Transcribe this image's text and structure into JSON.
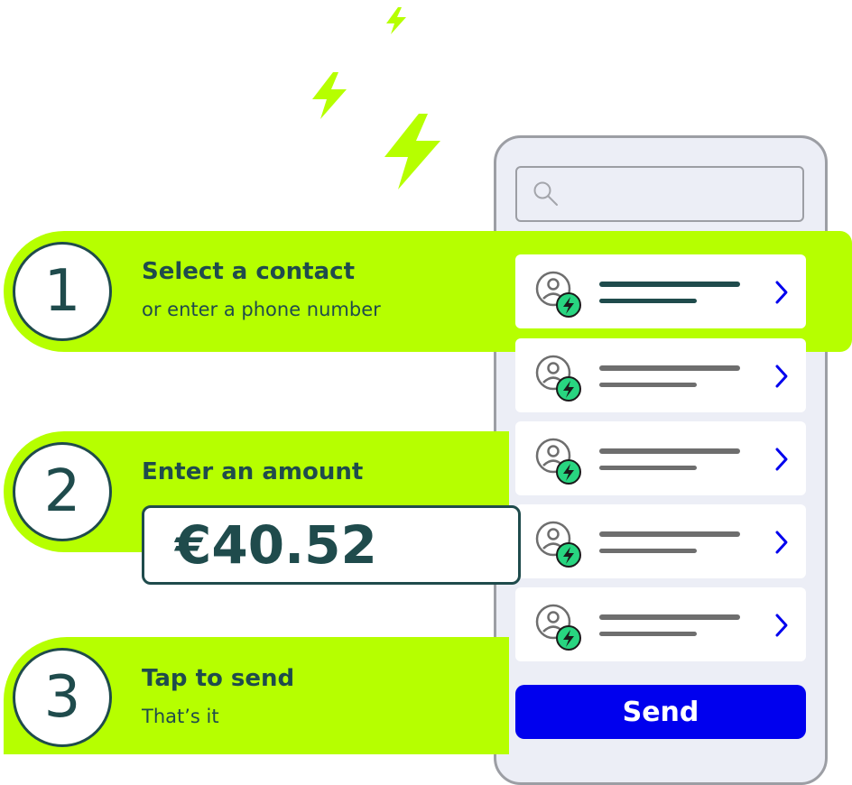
{
  "colors": {
    "accent_green": "#b6ff00",
    "dark_teal": "#1f4b4c",
    "send_blue": "#0000ee",
    "badge_green": "#28d580"
  },
  "steps": [
    {
      "number": "1",
      "title": "Select a contact",
      "subtitle": "or enter a phone number"
    },
    {
      "number": "2",
      "title": "Enter an amount",
      "amount": "€40.52"
    },
    {
      "number": "3",
      "title": "Tap to send",
      "subtitle": "That’s it"
    }
  ],
  "phone": {
    "search_icon": "search-icon",
    "contacts": [
      {
        "state": "selected",
        "avatar_icon": "user-lightning-icon",
        "chevron_icon": "chevron-right-icon"
      },
      {
        "state": "default",
        "avatar_icon": "user-lightning-icon",
        "chevron_icon": "chevron-right-icon"
      },
      {
        "state": "default",
        "avatar_icon": "user-lightning-icon",
        "chevron_icon": "chevron-right-icon"
      },
      {
        "state": "default",
        "avatar_icon": "user-lightning-icon",
        "chevron_icon": "chevron-right-icon"
      },
      {
        "state": "default",
        "avatar_icon": "user-lightning-icon",
        "chevron_icon": "chevron-right-icon"
      }
    ],
    "send_label": "Send"
  }
}
